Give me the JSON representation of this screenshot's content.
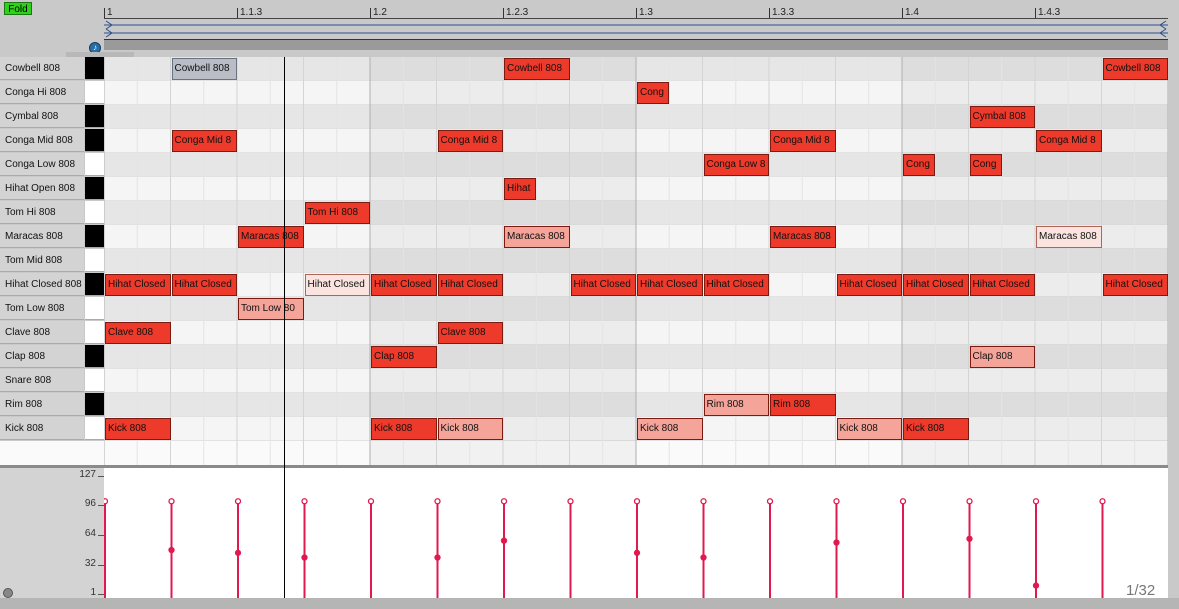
{
  "toolbar": {
    "fold_label": "Fold"
  },
  "ruler": {
    "marks": [
      "1",
      "1.1.3",
      "1.2",
      "1.2.3",
      "1.3",
      "1.3.3",
      "1.4",
      "1.4.3"
    ]
  },
  "loop": {
    "start": 1,
    "end": 5
  },
  "lanes": [
    {
      "label": "Cowbell 808",
      "key": "black"
    },
    {
      "label": "Conga Hi 808",
      "key": "white"
    },
    {
      "label": "Cymbal 808",
      "key": "black"
    },
    {
      "label": "Conga Mid 808",
      "key": "black"
    },
    {
      "label": "Conga Low 808",
      "key": "white"
    },
    {
      "label": "Hihat Open 808",
      "key": "black"
    },
    {
      "label": "Tom Hi 808",
      "key": "white"
    },
    {
      "label": "Maracas 808",
      "key": "black"
    },
    {
      "label": "Tom Mid 808",
      "key": "white"
    },
    {
      "label": "Hihat Closed 808",
      "key": "black"
    },
    {
      "label": "Tom Low 808",
      "key": "white"
    },
    {
      "label": "Clave 808",
      "key": "white"
    },
    {
      "label": "Clap 808",
      "key": "black"
    },
    {
      "label": "Snare 808",
      "key": "white"
    },
    {
      "label": "Rim 808",
      "key": "black"
    },
    {
      "label": "Kick 808",
      "key": "white"
    }
  ],
  "notes": [
    {
      "lane": 0,
      "step": 1,
      "len": 1,
      "text": "Cowbell 808",
      "style": "gray"
    },
    {
      "lane": 0,
      "step": 6,
      "len": 1,
      "text": "Cowbell 808",
      "style": "red"
    },
    {
      "lane": 0,
      "step": 15,
      "len": 1,
      "text": "Cowbell 808",
      "style": "red"
    },
    {
      "lane": 1,
      "step": 8,
      "len": 0.5,
      "text": "Cong",
      "style": "red"
    },
    {
      "lane": 2,
      "step": 13,
      "len": 1,
      "text": "Cymbal 808",
      "style": "red"
    },
    {
      "lane": 3,
      "step": 1,
      "len": 1,
      "text": "Conga Mid 8",
      "style": "red"
    },
    {
      "lane": 3,
      "step": 5,
      "len": 1,
      "text": "Conga Mid 8",
      "style": "red"
    },
    {
      "lane": 3,
      "step": 10,
      "len": 1,
      "text": "Conga Mid 8",
      "style": "red"
    },
    {
      "lane": 3,
      "step": 14,
      "len": 1,
      "text": "Conga Mid 8",
      "style": "red"
    },
    {
      "lane": 4,
      "step": 9,
      "len": 1,
      "text": "Conga Low 8",
      "style": "red"
    },
    {
      "lane": 4,
      "step": 12,
      "len": 0.5,
      "text": "Cong",
      "style": "red"
    },
    {
      "lane": 4,
      "step": 13,
      "len": 0.5,
      "text": "Cong",
      "style": "red"
    },
    {
      "lane": 5,
      "step": 6,
      "len": 0.5,
      "text": "Hihat",
      "style": "red"
    },
    {
      "lane": 6,
      "step": 3,
      "len": 1,
      "text": "Tom Hi 808",
      "style": "red"
    },
    {
      "lane": 7,
      "step": 2,
      "len": 1,
      "text": "Maracas 808",
      "style": "red"
    },
    {
      "lane": 7,
      "step": 6,
      "len": 1,
      "text": "Maracas 808",
      "style": "light"
    },
    {
      "lane": 7,
      "step": 10,
      "len": 1,
      "text": "Maracas 808",
      "style": "red"
    },
    {
      "lane": 7,
      "step": 14,
      "len": 1,
      "text": "Maracas 808",
      "style": "pale"
    },
    {
      "lane": 9,
      "step": 0,
      "len": 1,
      "text": "Hihat Closed",
      "style": "red"
    },
    {
      "lane": 9,
      "step": 1,
      "len": 1,
      "text": "Hihat Closed",
      "style": "red"
    },
    {
      "lane": 9,
      "step": 3,
      "len": 1,
      "text": "Hihat Closed",
      "style": "pale"
    },
    {
      "lane": 9,
      "step": 4,
      "len": 1,
      "text": "Hihat Closed",
      "style": "red"
    },
    {
      "lane": 9,
      "step": 5,
      "len": 1,
      "text": "Hihat Closed",
      "style": "red"
    },
    {
      "lane": 9,
      "step": 7,
      "len": 1,
      "text": "Hihat Closed",
      "style": "red"
    },
    {
      "lane": 9,
      "step": 8,
      "len": 1,
      "text": "Hihat Closed",
      "style": "red"
    },
    {
      "lane": 9,
      "step": 9,
      "len": 1,
      "text": "Hihat Closed",
      "style": "red"
    },
    {
      "lane": 9,
      "step": 11,
      "len": 1,
      "text": "Hihat Closed",
      "style": "red"
    },
    {
      "lane": 9,
      "step": 12,
      "len": 1,
      "text": "Hihat Closed",
      "style": "red"
    },
    {
      "lane": 9,
      "step": 13,
      "len": 1,
      "text": "Hihat Closed",
      "style": "red"
    },
    {
      "lane": 9,
      "step": 15,
      "len": 1,
      "text": "Hihat Closed",
      "style": "red"
    },
    {
      "lane": 10,
      "step": 2,
      "len": 1,
      "text": "Tom Low 80",
      "style": "light"
    },
    {
      "lane": 11,
      "step": 0,
      "len": 1,
      "text": "Clave 808",
      "style": "red"
    },
    {
      "lane": 11,
      "step": 5,
      "len": 1,
      "text": "Clave 808",
      "style": "red"
    },
    {
      "lane": 12,
      "step": 4,
      "len": 1,
      "text": "Clap 808",
      "style": "red"
    },
    {
      "lane": 12,
      "step": 13,
      "len": 1,
      "text": "Clap 808",
      "style": "light"
    },
    {
      "lane": 14,
      "step": 9,
      "len": 1,
      "text": "Rim 808",
      "style": "light"
    },
    {
      "lane": 14,
      "step": 10,
      "len": 1,
      "text": "Rim 808",
      "style": "red"
    },
    {
      "lane": 15,
      "step": 0,
      "len": 1,
      "text": "Kick 808",
      "style": "red"
    },
    {
      "lane": 15,
      "step": 4,
      "len": 1,
      "text": "Kick 808",
      "style": "red"
    },
    {
      "lane": 15,
      "step": 5,
      "len": 1,
      "text": "Kick 808",
      "style": "light"
    },
    {
      "lane": 15,
      "step": 8,
      "len": 1,
      "text": "Kick 808",
      "style": "light"
    },
    {
      "lane": 15,
      "step": 11,
      "len": 1,
      "text": "Kick 808",
      "style": "light"
    },
    {
      "lane": 15,
      "step": 12,
      "len": 1,
      "text": "Kick 808",
      "style": "red"
    }
  ],
  "velocity": {
    "axis_labels": [
      "127",
      "96",
      "64",
      "32",
      "1"
    ],
    "axis_values": [
      127,
      96,
      64,
      32,
      1
    ],
    "stems": [
      {
        "step": 0,
        "values": [
          100
        ]
      },
      {
        "step": 1,
        "values": [
          100,
          48
        ]
      },
      {
        "step": 2,
        "values": [
          100,
          45
        ]
      },
      {
        "step": 3,
        "values": [
          100,
          40
        ]
      },
      {
        "step": 4,
        "values": [
          100
        ]
      },
      {
        "step": 5,
        "values": [
          100,
          40
        ]
      },
      {
        "step": 6,
        "values": [
          100,
          58
        ]
      },
      {
        "step": 7,
        "values": [
          100
        ]
      },
      {
        "step": 8,
        "values": [
          100,
          45
        ]
      },
      {
        "step": 9,
        "values": [
          100,
          40
        ]
      },
      {
        "step": 10,
        "values": [
          100
        ]
      },
      {
        "step": 11,
        "values": [
          100,
          56
        ]
      },
      {
        "step": 12,
        "values": [
          100
        ]
      },
      {
        "step": 13,
        "values": [
          100,
          60
        ]
      },
      {
        "step": 14,
        "values": [
          100,
          10
        ]
      },
      {
        "step": 15,
        "values": [
          100
        ]
      }
    ]
  },
  "pager": {
    "text": "1/32"
  },
  "colors": {
    "note_red": "#ee3a2a",
    "note_light": "#f5a49a",
    "note_pale": "#fbe4df",
    "note_gray": "#b9bec6",
    "stem": "#e01a4f"
  },
  "icons": {
    "headphone": "headphone-icon",
    "play": "play-icon"
  }
}
